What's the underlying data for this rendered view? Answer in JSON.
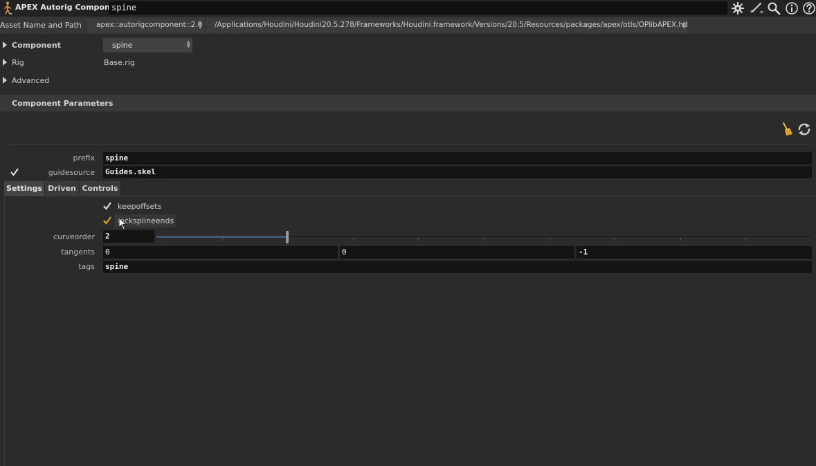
{
  "header": {
    "node_type": "APEX Autorig Component",
    "node_name": "spine",
    "icons": [
      "gear-icon",
      "brush-icon",
      "search-icon",
      "info-icon",
      "help-icon"
    ]
  },
  "asset": {
    "label": "Asset Name and Path",
    "name": "apex::autorigcomponent::2.0",
    "path": "/Applications/Houdini/Houdini20.5.278/Frameworks/Houdini.framework/Versions/20.5/Resources/packages/apex/otls/OPlibAPEX.hda"
  },
  "folders": {
    "component": {
      "label": "Component",
      "value": "spine"
    },
    "rig": {
      "label": "Rig",
      "value": "Base.rig"
    },
    "advanced": {
      "label": "Advanced"
    }
  },
  "section": {
    "title": "Component Parameters"
  },
  "params": {
    "prefix": {
      "label": "prefix",
      "value": "spine"
    },
    "guidesource": {
      "label": "guidesource",
      "value": "Guides.skel",
      "checked": true
    }
  },
  "tabs": [
    {
      "label": "Settings",
      "active": true
    },
    {
      "label": "Driven",
      "active": false
    },
    {
      "label": "Controls",
      "active": false
    }
  ],
  "settings": {
    "keepoffsets": {
      "label": "keepoffsets",
      "checked": true
    },
    "locksplineends": {
      "label": "locksplineends",
      "checked": true
    },
    "curveorder": {
      "label": "curveorder",
      "value": "2",
      "slider_fraction": 0.2
    },
    "tangents": {
      "label": "tangents",
      "values": [
        "0",
        "0",
        "-1"
      ]
    },
    "tags": {
      "label": "tags",
      "value": "spine"
    }
  },
  "colors": {
    "check_active": "#e8a020",
    "slider_fill": "#3a5a80",
    "background": "#2b2b2b"
  }
}
